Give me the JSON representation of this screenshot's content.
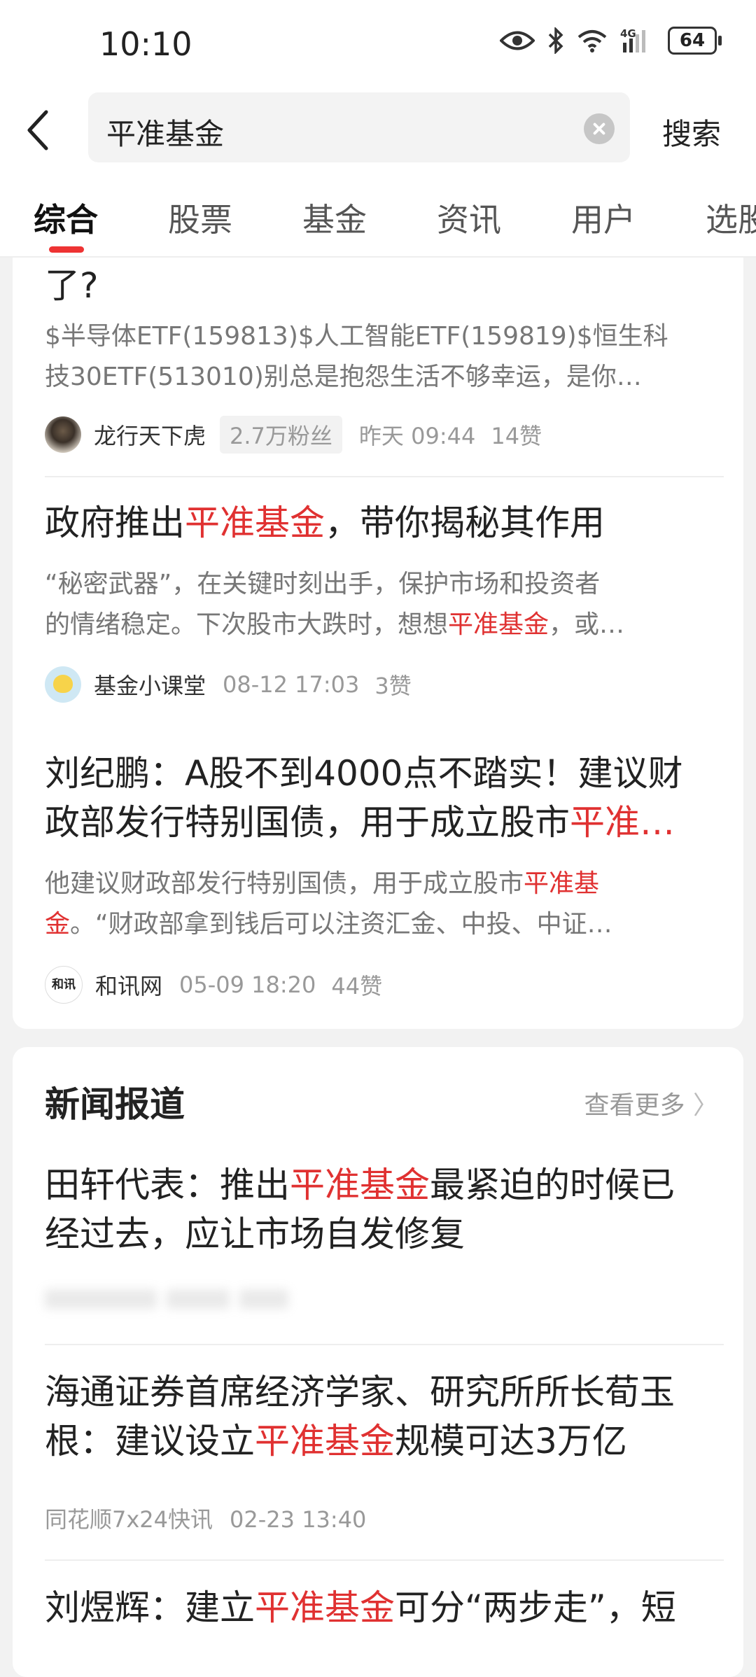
{
  "status": {
    "time": "10:10",
    "battery": "64",
    "network": "4G"
  },
  "search": {
    "query": "平准基金",
    "button": "搜索"
  },
  "tabs": [
    "综合",
    "股票",
    "基金",
    "资讯",
    "用户",
    "选股"
  ],
  "articles": [
    {
      "title_tail": "了?",
      "summary_lines": [
        "$半导体ETF(159813)$人工智能ETF(159819)$恒生科",
        "技30ETF(513010)别总是抱怨生活不够幸运，是你…"
      ],
      "author": "龙行天下虎",
      "fans": "2.7万粉丝",
      "time": "昨天 09:44",
      "likes": "14赞"
    },
    {
      "title_pre": "政府推出",
      "title_hl": "平准基金",
      "title_post": "，带你揭秘其作用",
      "summary_l1": "“秘密武器”，在关键时刻出手，保护市场和投资者",
      "summary_l2_pre": "的情绪稳定。下次股市大跌时，想想",
      "summary_l2_hl": "平准基金",
      "summary_l2_post": "，或…",
      "author": "基金小课堂",
      "time": "08-12 17:03",
      "likes": "3赞"
    },
    {
      "title_l1": "刘纪鹏：A股不到4000点不踏实！建议财",
      "title_l2_pre": "政部发行特别国债，用于成立股市",
      "title_l2_hl": "平准…",
      "summary_l1_pre": "他建议财政部发行特别国债，用于成立股市",
      "summary_l1_hl": "平准基",
      "summary_l2_hl": "金",
      "summary_l2_post": "。“财政部拿到钱后可以注资汇金、中投、中证…",
      "author": "和讯网",
      "avatar_text": "和讯",
      "time": "05-09 18:20",
      "likes": "44赞"
    }
  ],
  "news": {
    "section_title": "新闻报道",
    "see_more": "查看更多",
    "items": [
      {
        "l1_pre": "田轩代表：推出",
        "l1_hl": "平准基金",
        "l1_post": "最紧迫的时候已",
        "l2": "经过去，应让市场自发修复"
      },
      {
        "l1": "海通证券首席经济学家、研究所所长荀玉",
        "l2_pre": "根：建议设立",
        "l2_hl": "平准基金",
        "l2_post": "规模可达3万亿",
        "source": "同花顺7x24快讯",
        "time": "02-23 13:40"
      },
      {
        "l1_pre": "刘煜辉：建立",
        "l1_hl": "平准基金",
        "l1_post": "可分“两步走”，短"
      }
    ]
  },
  "colors": {
    "highlight": "#e03131",
    "tab_indicator": "#e33333"
  }
}
